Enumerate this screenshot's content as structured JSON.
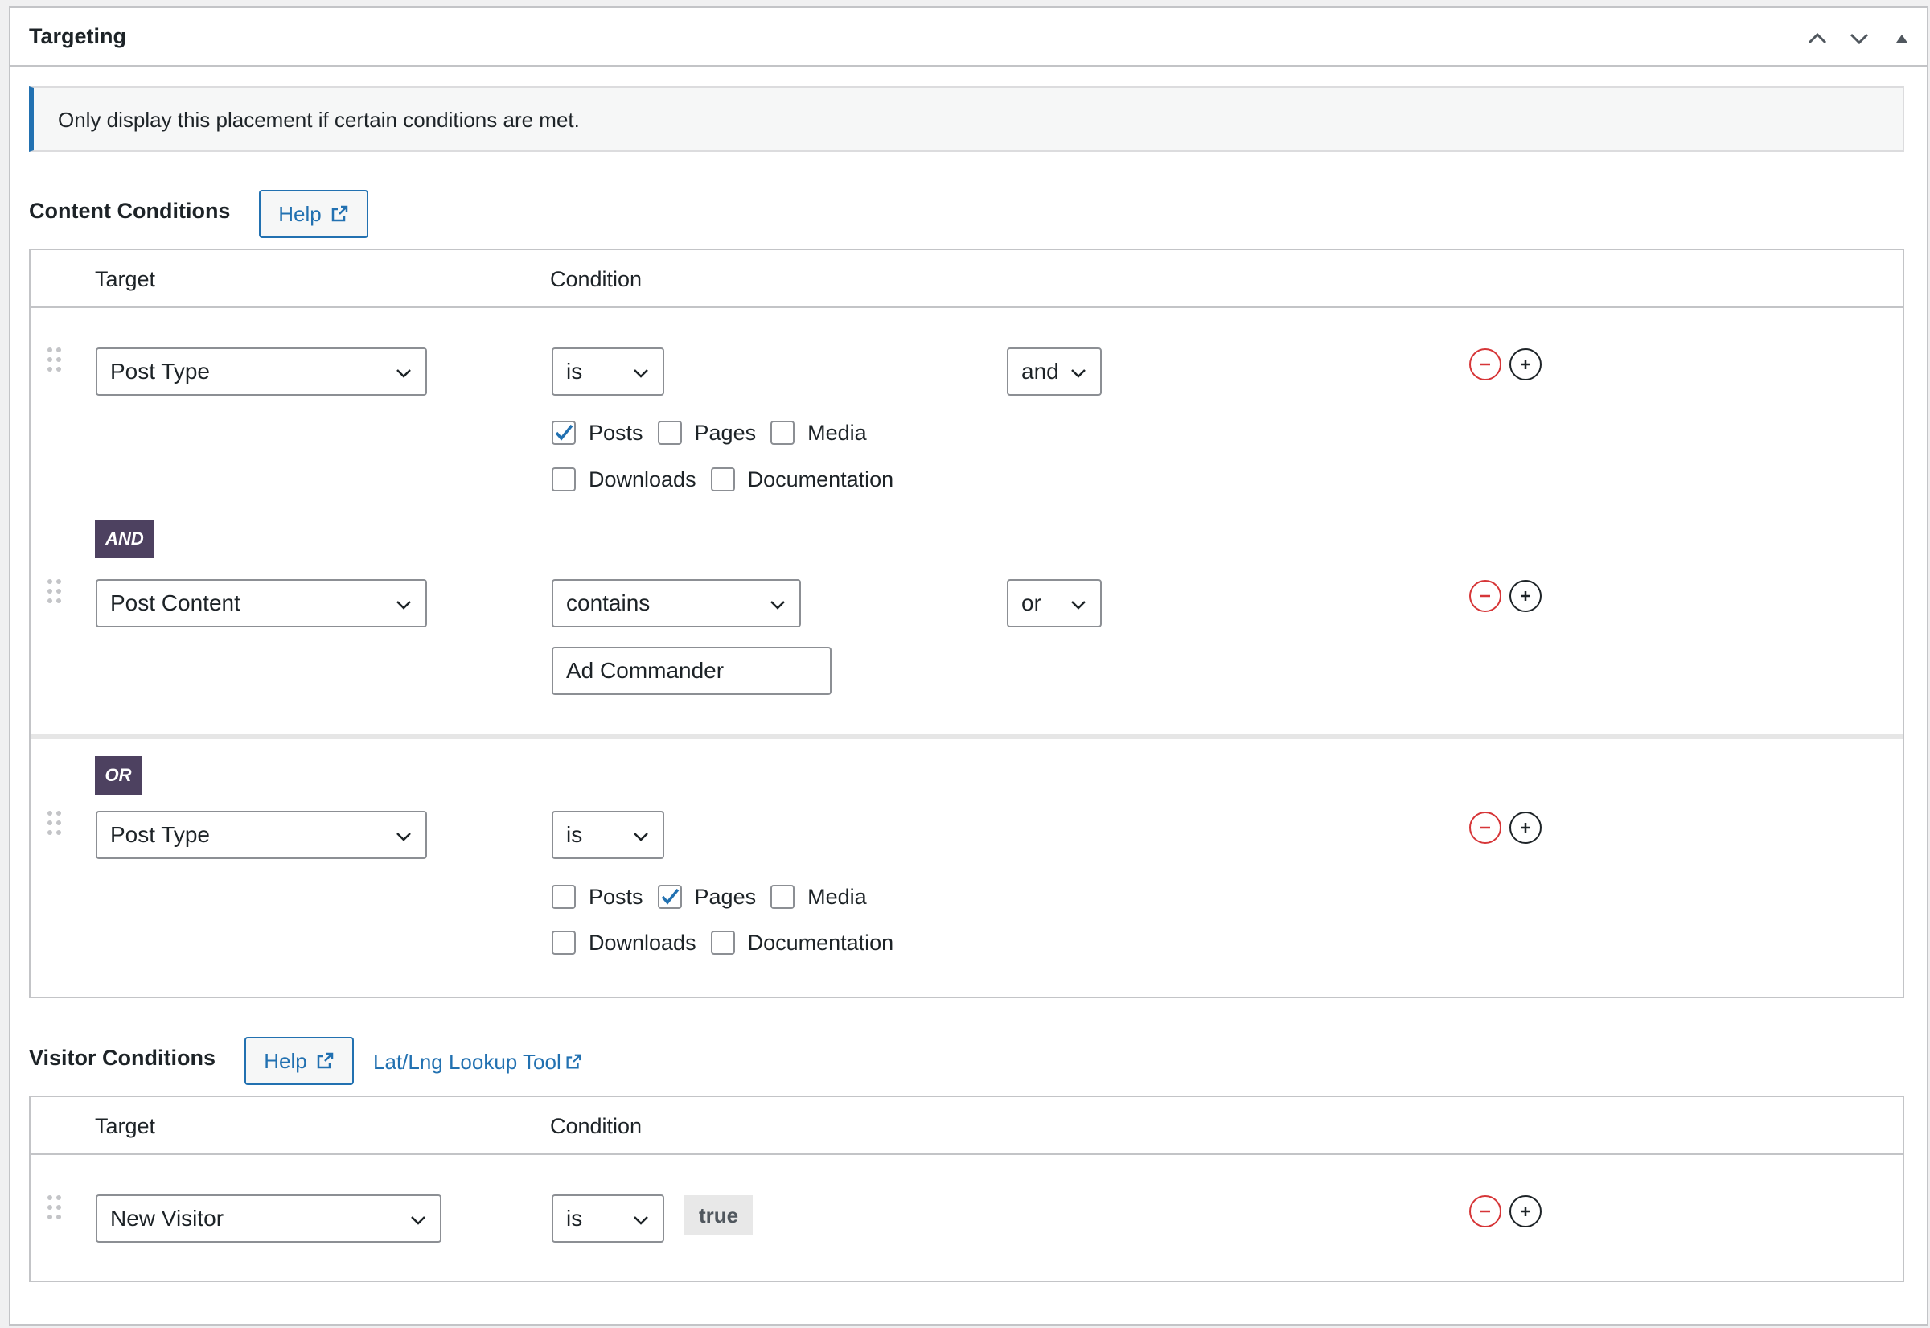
{
  "panel": {
    "title": "Targeting"
  },
  "notice": {
    "text": "Only display this placement if certain conditions are met."
  },
  "content_conditions": {
    "label": "Content Conditions",
    "help_label": "Help",
    "columns": {
      "target": "Target",
      "condition": "Condition"
    },
    "rows": [
      {
        "target": "Post Type",
        "operator": "is",
        "connector": "and",
        "checkboxes": [
          {
            "label": "Posts",
            "checked": true
          },
          {
            "label": "Pages",
            "checked": false
          },
          {
            "label": "Media",
            "checked": false
          },
          {
            "label": "Downloads",
            "checked": false
          },
          {
            "label": "Documentation",
            "checked": false
          }
        ]
      },
      {
        "badge": "AND",
        "target": "Post Content",
        "operator": "contains",
        "connector": "or",
        "value": "Ad Commander"
      },
      {
        "badge": "OR",
        "target": "Post Type",
        "operator": "is",
        "checkboxes": [
          {
            "label": "Posts",
            "checked": false
          },
          {
            "label": "Pages",
            "checked": true
          },
          {
            "label": "Media",
            "checked": false
          },
          {
            "label": "Downloads",
            "checked": false
          },
          {
            "label": "Documentation",
            "checked": false
          }
        ]
      }
    ]
  },
  "visitor_conditions": {
    "label": "Visitor Conditions",
    "help_label": "Help",
    "lookup_link": "Lat/Lng Lookup Tool",
    "columns": {
      "target": "Target",
      "condition": "Condition"
    },
    "rows": [
      {
        "target": "New Visitor",
        "operator": "is",
        "value": "true"
      }
    ]
  },
  "colors": {
    "accent": "#2271b1",
    "badge": "#4d4160",
    "remove": "#d63638"
  }
}
